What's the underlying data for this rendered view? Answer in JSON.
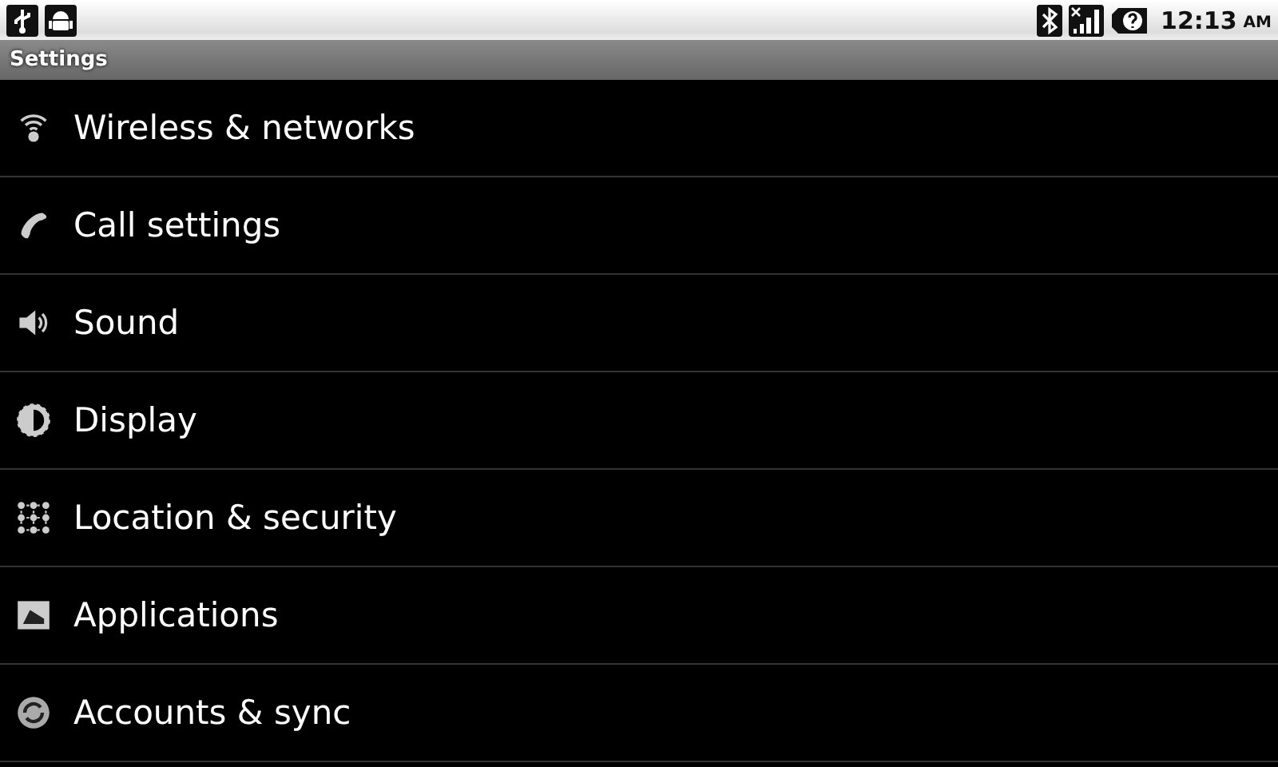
{
  "status_bar": {
    "time": "12:13",
    "meridiem": "AM"
  },
  "title_bar": {
    "title": "Settings"
  },
  "items": [
    {
      "label": "Wireless & networks",
      "kind": "wifi"
    },
    {
      "label": "Call settings",
      "kind": "phone"
    },
    {
      "label": "Sound",
      "kind": "speaker"
    },
    {
      "label": "Display",
      "kind": "brightness"
    },
    {
      "label": "Location & security",
      "kind": "grid"
    },
    {
      "label": "Applications",
      "kind": "apps"
    },
    {
      "label": "Accounts & sync",
      "kind": "sync"
    }
  ]
}
